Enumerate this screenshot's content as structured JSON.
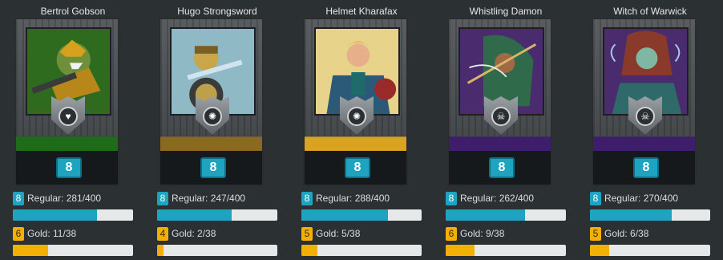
{
  "cards": [
    {
      "name": "Bertrol Gobson",
      "level": "8",
      "art_bg": "#2e6b1e",
      "banner_color": "#1f6b1a",
      "icon": "heart-icon",
      "icon_glyph": "♥",
      "regular_level": "8",
      "regular_label": "Regular: 281/400",
      "regular_progress": 0.7025,
      "gold_level": "6",
      "gold_label": "Gold: 11/38",
      "gold_progress": 0.289
    },
    {
      "name": "Hugo Strongsword",
      "level": "8",
      "art_bg": "#8fb9c4",
      "banner_color": "#8a6a1f",
      "icon": "sun-icon",
      "icon_glyph": "✺",
      "regular_level": "8",
      "regular_label": "Regular: 247/400",
      "regular_progress": 0.6175,
      "gold_level": "4",
      "gold_label": "Gold: 2/38",
      "gold_progress": 0.053
    },
    {
      "name": "Helmet Kharafax",
      "level": "8",
      "art_bg": "#e8d38a",
      "banner_color": "#d9a21f",
      "icon": "sun-icon",
      "icon_glyph": "✺",
      "regular_level": "8",
      "regular_label": "Regular: 288/400",
      "regular_progress": 0.72,
      "gold_level": "5",
      "gold_label": "Gold: 5/38",
      "gold_progress": 0.132
    },
    {
      "name": "Whistling Damon",
      "level": "8",
      "art_bg": "#4a2c6e",
      "banner_color": "#3e1d6b",
      "icon": "skull-icon",
      "icon_glyph": "☠",
      "regular_level": "8",
      "regular_label": "Regular: 262/400",
      "regular_progress": 0.655,
      "gold_level": "6",
      "gold_label": "Gold: 9/38",
      "gold_progress": 0.237
    },
    {
      "name": "Witch of Warwick",
      "level": "8",
      "art_bg": "#4a2c6e",
      "banner_color": "#3e1d6b",
      "icon": "skull-icon",
      "icon_glyph": "☠",
      "regular_level": "8",
      "regular_label": "Regular: 270/400",
      "regular_progress": 0.675,
      "gold_level": "5",
      "gold_label": "Gold: 6/38",
      "gold_progress": 0.158
    }
  ]
}
